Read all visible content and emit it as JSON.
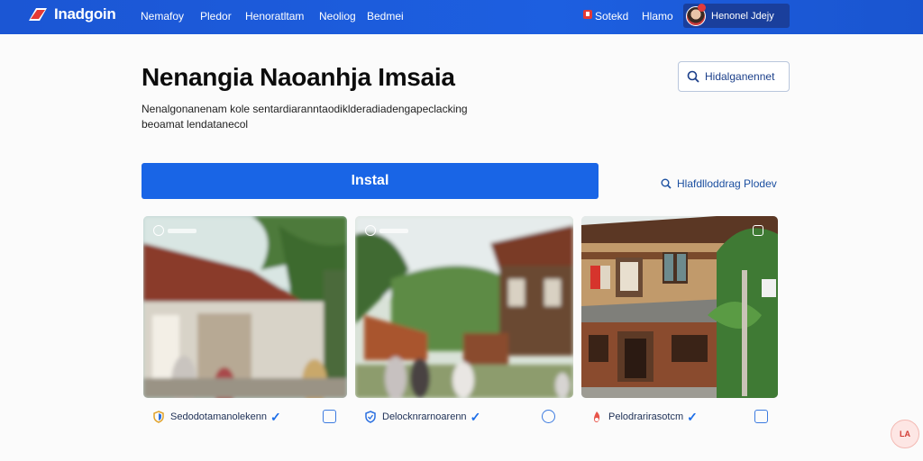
{
  "app": {
    "brand": "Inadgoin",
    "colors": {
      "nav": "#1b56d4",
      "accent": "#1965e6",
      "link": "#1a5fd6"
    }
  },
  "nav": {
    "links": [
      "Nemafoy",
      "Pledor",
      "Henoratltam",
      "Neoliog",
      "Bedmei"
    ],
    "right_links": [
      "Sotekd",
      "Hlamo"
    ],
    "user_name": "Henonel Jdejy",
    "icons": [
      "logo-flag-icon",
      "notification-icon",
      "avatar"
    ]
  },
  "header": {
    "title": "Nenangia Naoanhja Imsaia",
    "description": "Nenalgonanenam kole sentardiaranntaodiklderadiadengapeclacking",
    "description_line2_text": "beoamat lendatanecol",
    "description_line2_link": "",
    "search_label": "Hidalganennet",
    "install_label": "Instal",
    "side_link_label": "Hlafdlloddrag Plodev"
  },
  "cards": [
    {
      "caption": "Sedodotamanolekenn",
      "icon": "shield-icon",
      "action_icon": "edit-icon"
    },
    {
      "caption": "Delocknrarnoarenn",
      "icon": "shield-icon",
      "action_icon": "clock-icon"
    },
    {
      "caption": "Pelodrarirasotcm",
      "icon": "flame-icon",
      "action_icon": "check-box-icon"
    }
  ],
  "fab": {
    "label": "LA"
  }
}
